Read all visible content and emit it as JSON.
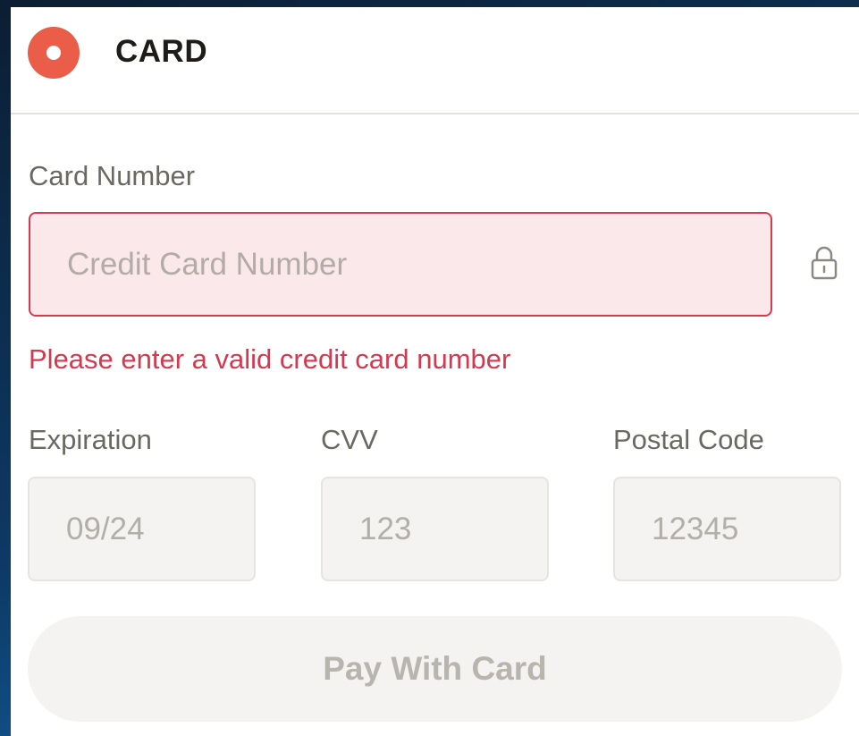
{
  "header": {
    "title": "CARD",
    "radio_selected": true
  },
  "card_number": {
    "label": "Card Number",
    "placeholder": "Credit Card Number",
    "value": "",
    "error": "Please enter a valid credit card number",
    "lock_icon": "lock-icon"
  },
  "expiration": {
    "label": "Expiration",
    "placeholder": "09/24",
    "value": ""
  },
  "cvv": {
    "label": "CVV",
    "placeholder": "123",
    "value": ""
  },
  "postal_code": {
    "label": "Postal Code",
    "placeholder": "12345",
    "value": ""
  },
  "pay_button": {
    "label": "Pay With Card",
    "enabled": false
  },
  "colors": {
    "accent": "#ea5d49",
    "error": "#d33a4f",
    "error_bg": "#fae8ea",
    "input_bg": "#f4f3f1",
    "background_top": "#0b1e33",
    "background_bottom": "#1572b8"
  }
}
